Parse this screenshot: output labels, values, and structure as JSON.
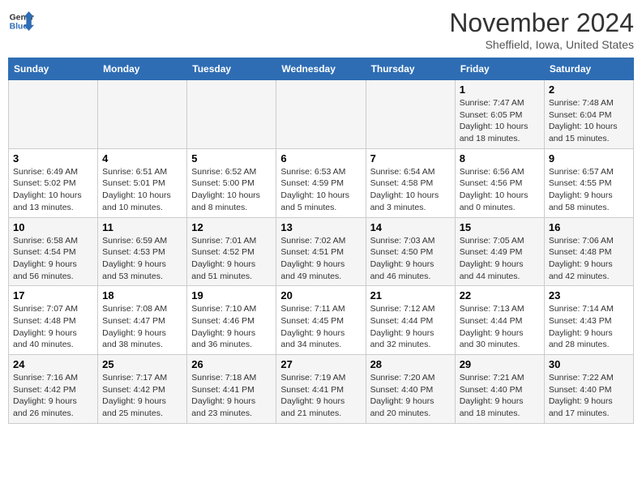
{
  "logo": {
    "line1": "General",
    "line2": "Blue"
  },
  "title": "November 2024",
  "subtitle": "Sheffield, Iowa, United States",
  "days_of_week": [
    "Sunday",
    "Monday",
    "Tuesday",
    "Wednesday",
    "Thursday",
    "Friday",
    "Saturday"
  ],
  "weeks": [
    [
      {
        "day": "",
        "info": ""
      },
      {
        "day": "",
        "info": ""
      },
      {
        "day": "",
        "info": ""
      },
      {
        "day": "",
        "info": ""
      },
      {
        "day": "",
        "info": ""
      },
      {
        "day": "1",
        "info": "Sunrise: 7:47 AM\nSunset: 6:05 PM\nDaylight: 10 hours and 18 minutes."
      },
      {
        "day": "2",
        "info": "Sunrise: 7:48 AM\nSunset: 6:04 PM\nDaylight: 10 hours and 15 minutes."
      }
    ],
    [
      {
        "day": "3",
        "info": "Sunrise: 6:49 AM\nSunset: 5:02 PM\nDaylight: 10 hours and 13 minutes."
      },
      {
        "day": "4",
        "info": "Sunrise: 6:51 AM\nSunset: 5:01 PM\nDaylight: 10 hours and 10 minutes."
      },
      {
        "day": "5",
        "info": "Sunrise: 6:52 AM\nSunset: 5:00 PM\nDaylight: 10 hours and 8 minutes."
      },
      {
        "day": "6",
        "info": "Sunrise: 6:53 AM\nSunset: 4:59 PM\nDaylight: 10 hours and 5 minutes."
      },
      {
        "day": "7",
        "info": "Sunrise: 6:54 AM\nSunset: 4:58 PM\nDaylight: 10 hours and 3 minutes."
      },
      {
        "day": "8",
        "info": "Sunrise: 6:56 AM\nSunset: 4:56 PM\nDaylight: 10 hours and 0 minutes."
      },
      {
        "day": "9",
        "info": "Sunrise: 6:57 AM\nSunset: 4:55 PM\nDaylight: 9 hours and 58 minutes."
      }
    ],
    [
      {
        "day": "10",
        "info": "Sunrise: 6:58 AM\nSunset: 4:54 PM\nDaylight: 9 hours and 56 minutes."
      },
      {
        "day": "11",
        "info": "Sunrise: 6:59 AM\nSunset: 4:53 PM\nDaylight: 9 hours and 53 minutes."
      },
      {
        "day": "12",
        "info": "Sunrise: 7:01 AM\nSunset: 4:52 PM\nDaylight: 9 hours and 51 minutes."
      },
      {
        "day": "13",
        "info": "Sunrise: 7:02 AM\nSunset: 4:51 PM\nDaylight: 9 hours and 49 minutes."
      },
      {
        "day": "14",
        "info": "Sunrise: 7:03 AM\nSunset: 4:50 PM\nDaylight: 9 hours and 46 minutes."
      },
      {
        "day": "15",
        "info": "Sunrise: 7:05 AM\nSunset: 4:49 PM\nDaylight: 9 hours and 44 minutes."
      },
      {
        "day": "16",
        "info": "Sunrise: 7:06 AM\nSunset: 4:48 PM\nDaylight: 9 hours and 42 minutes."
      }
    ],
    [
      {
        "day": "17",
        "info": "Sunrise: 7:07 AM\nSunset: 4:48 PM\nDaylight: 9 hours and 40 minutes."
      },
      {
        "day": "18",
        "info": "Sunrise: 7:08 AM\nSunset: 4:47 PM\nDaylight: 9 hours and 38 minutes."
      },
      {
        "day": "19",
        "info": "Sunrise: 7:10 AM\nSunset: 4:46 PM\nDaylight: 9 hours and 36 minutes."
      },
      {
        "day": "20",
        "info": "Sunrise: 7:11 AM\nSunset: 4:45 PM\nDaylight: 9 hours and 34 minutes."
      },
      {
        "day": "21",
        "info": "Sunrise: 7:12 AM\nSunset: 4:44 PM\nDaylight: 9 hours and 32 minutes."
      },
      {
        "day": "22",
        "info": "Sunrise: 7:13 AM\nSunset: 4:44 PM\nDaylight: 9 hours and 30 minutes."
      },
      {
        "day": "23",
        "info": "Sunrise: 7:14 AM\nSunset: 4:43 PM\nDaylight: 9 hours and 28 minutes."
      }
    ],
    [
      {
        "day": "24",
        "info": "Sunrise: 7:16 AM\nSunset: 4:42 PM\nDaylight: 9 hours and 26 minutes."
      },
      {
        "day": "25",
        "info": "Sunrise: 7:17 AM\nSunset: 4:42 PM\nDaylight: 9 hours and 25 minutes."
      },
      {
        "day": "26",
        "info": "Sunrise: 7:18 AM\nSunset: 4:41 PM\nDaylight: 9 hours and 23 minutes."
      },
      {
        "day": "27",
        "info": "Sunrise: 7:19 AM\nSunset: 4:41 PM\nDaylight: 9 hours and 21 minutes."
      },
      {
        "day": "28",
        "info": "Sunrise: 7:20 AM\nSunset: 4:40 PM\nDaylight: 9 hours and 20 minutes."
      },
      {
        "day": "29",
        "info": "Sunrise: 7:21 AM\nSunset: 4:40 PM\nDaylight: 9 hours and 18 minutes."
      },
      {
        "day": "30",
        "info": "Sunrise: 7:22 AM\nSunset: 4:40 PM\nDaylight: 9 hours and 17 minutes."
      }
    ]
  ]
}
